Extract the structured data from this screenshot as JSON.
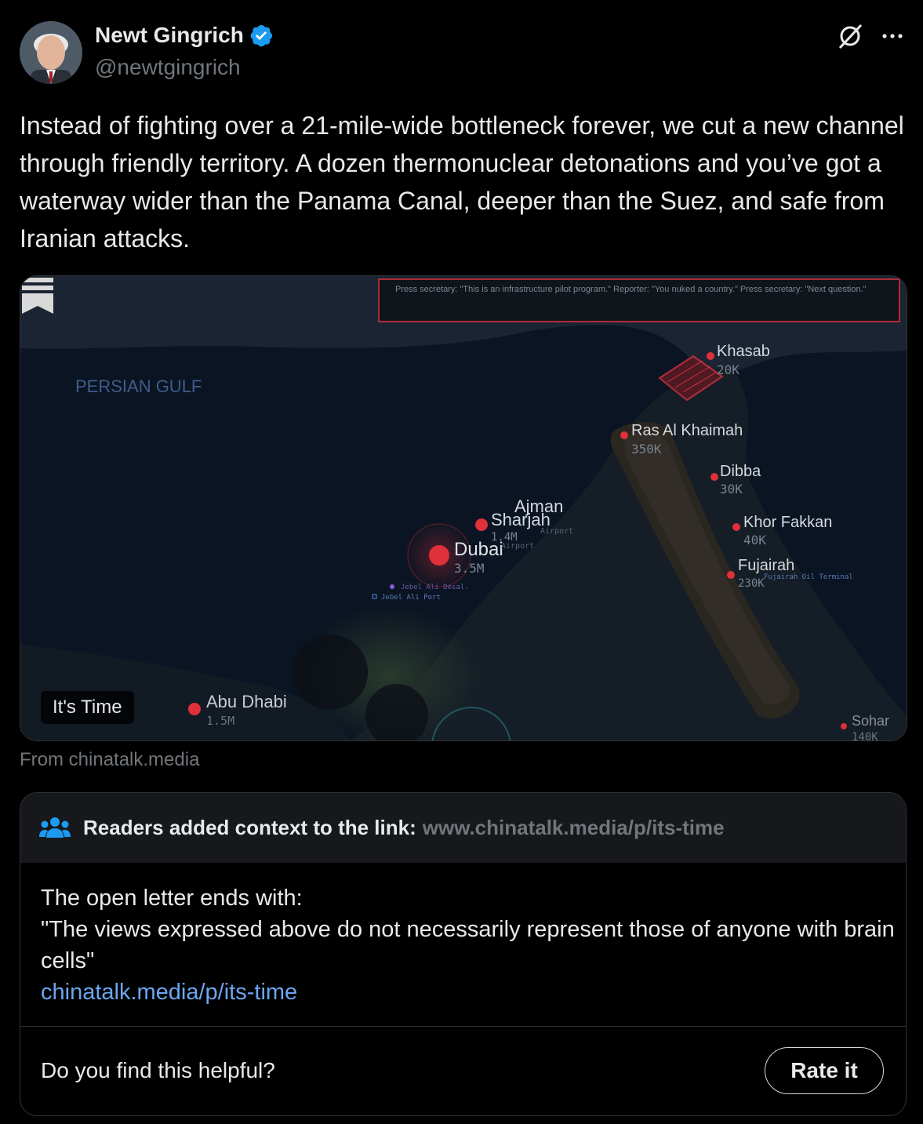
{
  "author": {
    "name": "Newt Gingrich",
    "handle": "@newtgingrich"
  },
  "tweet": {
    "text": "Instead of fighting over a 21-mile-wide bottleneck forever, we cut a new channel through friendly territory. A dozen thermonuclear detonations and you’ve got a waterway wider than the Panama Canal, deeper than the Suez, and safe from Iranian attacks."
  },
  "media": {
    "badge": "It's Time",
    "source": "From chinatalk.media",
    "map": {
      "caption": "Press secretary: \"This is an infrastructure pilot program.\" Reporter: \"You nuked a country.\" Press secretary: \"Next question.\"",
      "sea_label": "PERSIAN GULF",
      "cities": [
        {
          "name": "Khasab",
          "pop": "20K"
        },
        {
          "name": "Ras Al Khaimah",
          "pop": "350K"
        },
        {
          "name": "Dibba",
          "pop": "30K"
        },
        {
          "name": "Ajman",
          "pop": ""
        },
        {
          "name": "Sharjah",
          "pop": "1.4M"
        },
        {
          "name": "Dubai",
          "pop": "3.5M"
        },
        {
          "name": "Khor Fakkan",
          "pop": "40K"
        },
        {
          "name": "Fujairah",
          "pop": "230K"
        },
        {
          "name": "Abu Dhabi",
          "pop": "1.5M"
        },
        {
          "name": "Sohar",
          "pop": "140K"
        }
      ],
      "minor_labels": [
        "Airport",
        "Airport",
        "Jebel Ali Desal.",
        "Jebel Ali Port",
        "Fujairah Oil Terminal"
      ]
    }
  },
  "community_note": {
    "title": "Readers added context to the link:",
    "url": "www.chinatalk.media/p/its-time",
    "lines": [
      "The open letter ends with:",
      "\"The views expressed above do not necessarily represent those of anyone with brain cells\""
    ],
    "link": "chinatalk.media/p/its-time",
    "question": "Do you find this helpful?",
    "rate_label": "Rate it"
  },
  "colors": {
    "verified": "#1d9bf0",
    "link": "#6ca6f0",
    "city_marker": "#e0303a"
  }
}
